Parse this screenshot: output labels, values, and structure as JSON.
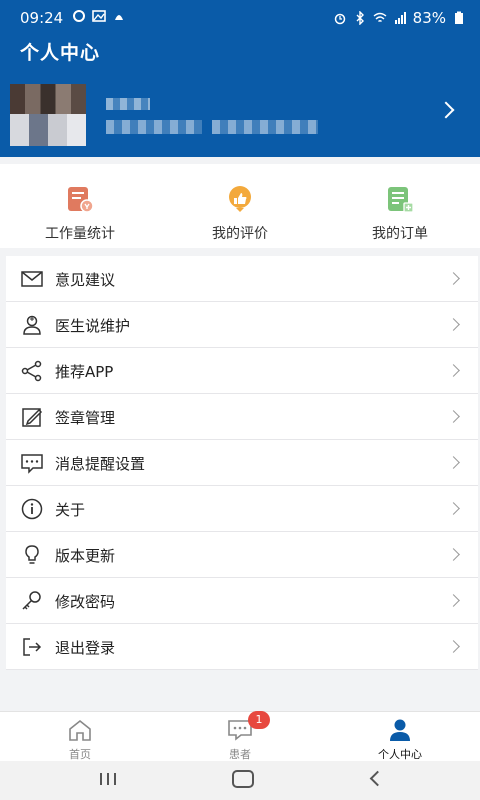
{
  "status": {
    "time": "09:24",
    "battery": "83%"
  },
  "header": {
    "title": "个人中心"
  },
  "quick_actions": [
    {
      "label": "工作量统计",
      "icon": "workload-stats-icon",
      "color": "#e07a5f"
    },
    {
      "label": "我的评价",
      "icon": "thumbs-up-icon",
      "color": "#f3a93c"
    },
    {
      "label": "我的订单",
      "icon": "order-list-icon",
      "color": "#7cc47a"
    }
  ],
  "menu": [
    {
      "label": "意见建议",
      "icon": "envelope-icon"
    },
    {
      "label": "医生说维护",
      "icon": "doctor-icon"
    },
    {
      "label": "推荐APP",
      "icon": "share-icon"
    },
    {
      "label": "签章管理",
      "icon": "signature-icon"
    },
    {
      "label": "消息提醒设置",
      "icon": "message-icon"
    },
    {
      "label": "关于",
      "icon": "info-icon"
    },
    {
      "label": "版本更新",
      "icon": "lightbulb-icon"
    },
    {
      "label": "修改密码",
      "icon": "key-icon"
    },
    {
      "label": "退出登录",
      "icon": "logout-icon"
    }
  ],
  "tabs": [
    {
      "label": "首页",
      "icon": "home-icon"
    },
    {
      "label": "患者",
      "icon": "chat-icon",
      "badge": "1"
    },
    {
      "label": "个人中心",
      "icon": "user-icon"
    }
  ],
  "colors": {
    "header_bg": "#0a5ba8",
    "badge": "#e7483f"
  }
}
